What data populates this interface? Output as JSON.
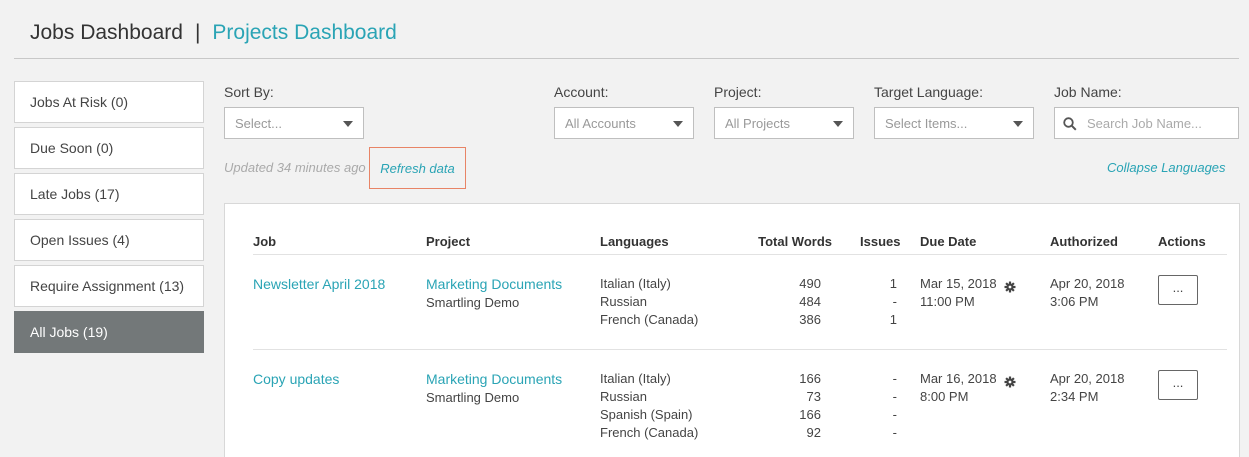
{
  "header": {
    "jobs_title": "Jobs Dashboard",
    "separator": "|",
    "projects_title": "Projects Dashboard"
  },
  "sidebar": {
    "items": [
      {
        "label": "Jobs At Risk (0)"
      },
      {
        "label": "Due Soon (0)"
      },
      {
        "label": "Late Jobs (17)"
      },
      {
        "label": "Open Issues (4)"
      },
      {
        "label": "Require Assignment (13)"
      },
      {
        "label": "All Jobs (19)",
        "active": true
      }
    ]
  },
  "filters": {
    "sort_label": "Sort By:",
    "sort_value": "Select...",
    "account_label": "Account:",
    "account_value": "All Accounts",
    "project_label": "Project:",
    "project_value": "All Projects",
    "target_label": "Target Language:",
    "target_value": "Select Items...",
    "jobname_label": "Job Name:",
    "jobname_placeholder": "Search Job Name..."
  },
  "status": {
    "updated": "Updated 34 minutes ago",
    "refresh": "Refresh data",
    "collapse": "Collapse Languages"
  },
  "table": {
    "headers": {
      "job": "Job",
      "project": "Project",
      "languages": "Languages",
      "total_words": "Total Words",
      "issues": "Issues",
      "due_date": "Due Date",
      "authorized": "Authorized",
      "actions": "Actions"
    },
    "rows": [
      {
        "job": "Newsletter April 2018",
        "project": "Marketing Documents",
        "account": "Smartling Demo",
        "languages": "Italian (Italy)\nRussian\nFrench (Canada)",
        "words": "490\n484\n386",
        "issues": "1\n-\n1",
        "due": "Mar 15, 2018\n11:00 PM",
        "authorized": "Apr 20, 2018\n3:06 PM",
        "action": "..."
      },
      {
        "job": "Copy updates",
        "project": "Marketing Documents",
        "account": "Smartling Demo",
        "languages": "Italian (Italy)\nRussian\nSpanish (Spain)\nFrench (Canada)",
        "words": "166\n73\n166\n92",
        "issues": "-\n-\n-\n-",
        "due": "Mar 16, 2018\n8:00 PM",
        "authorized": "Apr 20, 2018\n2:34 PM",
        "action": "..."
      }
    ]
  },
  "icons": {
    "search": "search-icon",
    "gear": "gear-icon",
    "caret": "chevron-down-icon"
  },
  "colors": {
    "accent": "#2aa4b5",
    "active_sidebar": "#737879",
    "highlight_border": "#e88466"
  }
}
